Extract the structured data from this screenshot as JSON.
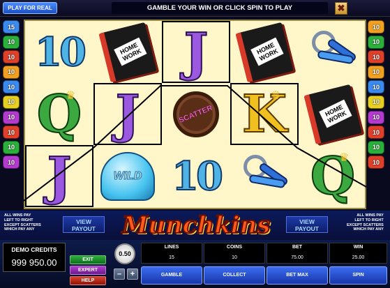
{
  "topbar": {
    "play_for_real": "PLAY FOR REAL",
    "message": "GAMBLE YOUR WIN OR CLICK SPIN TO PLAY",
    "close_label": "✖"
  },
  "paylines": {
    "left": [
      "15",
      "10",
      "10",
      "10",
      "10",
      "10",
      "10",
      "10",
      "10",
      "10",
      "10",
      "10",
      "10"
    ],
    "right": [
      "10",
      "10",
      "10",
      "10",
      "10",
      "10",
      "10",
      "10",
      "10",
      "10",
      "10",
      "10",
      "10"
    ],
    "left_colors": [
      "#3a8af0",
      "#2bb03b",
      "#e0402a",
      "#f2a020",
      "#3a8af0",
      "#e8d020",
      "#b43ad0",
      "#e0402a",
      "#2bb03b",
      "#b43ad0"
    ],
    "right_colors": [
      "#f2a020",
      "#2bb03b",
      "#e0402a",
      "#f2a020",
      "#3a8af0",
      "#e8d020",
      "#b43ad0",
      "#e0402a",
      "#2bb03b",
      "#e0402a"
    ],
    "left_labels": [
      "15",
      "10",
      "10",
      "10",
      "10",
      "10",
      "10",
      "10",
      "10",
      "10"
    ],
    "right_labels": [
      "10",
      "10",
      "10",
      "10",
      "10",
      "10",
      "10",
      "10",
      "10",
      "10"
    ]
  },
  "reels": [
    [
      "10",
      "Q",
      "J"
    ],
    [
      "book",
      "J",
      "wild"
    ],
    [
      "J",
      "scatter",
      "10"
    ],
    [
      "book",
      "K",
      "keys"
    ],
    [
      "keys",
      "book",
      "Q"
    ]
  ],
  "symbols": {
    "book_label": "HOME WORK",
    "scatter_label": "SCATTER",
    "wild_label": "WILD"
  },
  "rules_left": [
    "ALL WINS PAY",
    "LEFT TO RIGHT",
    "EXCEPT SCATTERS",
    "WHICH PAY ANY"
  ],
  "rules_right": [
    "ALL WINS PAY",
    "LEFT TO RIGHT",
    "EXCEPT SCATTERS",
    "WHICH PAY ANY"
  ],
  "view_payout": "VIEW PAYOUT",
  "logo": "Munchkins",
  "bottom": {
    "credits_title": "DEMO CREDITS",
    "credits_value": "999 950.00",
    "exit": "EXIT",
    "expert": "EXPERT",
    "help": "HELP",
    "coin_value": "0.50",
    "minus": "–",
    "plus": "+",
    "stats": [
      {
        "label": "LINES",
        "value": "15"
      },
      {
        "label": "COINS",
        "value": "10"
      },
      {
        "label": "BET",
        "value": "75.00"
      },
      {
        "label": "WIN",
        "value": "25.00"
      }
    ],
    "actions": [
      "GAMBLE",
      "COLLECT",
      "BET MAX",
      "SPIN"
    ]
  },
  "colors": {
    "reel_bg": "#fff7c9",
    "winline": "#000000"
  }
}
